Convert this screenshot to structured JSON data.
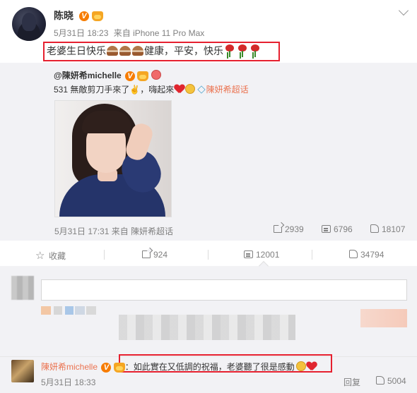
{
  "post": {
    "author": "陈晓",
    "date": "5月31日 18:23",
    "source": "来自 iPhone 11 Pro Max",
    "text_a": "老婆生日快乐",
    "text_b": "健康，平安，快乐"
  },
  "repost": {
    "author": "@陳妍希michelle",
    "text": "531 無敵剪刀手來了✌️，嗨起來",
    "super_topic": "陳妍希超话",
    "meta": "5月31日 17:31 来自 陳妍希超话",
    "reposts": "2939",
    "comments": "6796",
    "likes": "18107"
  },
  "actions": {
    "favorite": "收藏",
    "reposts": "924",
    "comments": "12001",
    "likes": "34794"
  },
  "reply": {
    "author": "陳妍希michelle",
    "text": "：如此實在又低調的祝福，老婆聽了很是感動",
    "date": "5月31日 18:33",
    "reply_label": "回复",
    "likes": "5004"
  },
  "colors": {
    "accent": "#eb7350",
    "highlight_box": "#e6202f",
    "panel_bg": "#f2f2f5"
  }
}
